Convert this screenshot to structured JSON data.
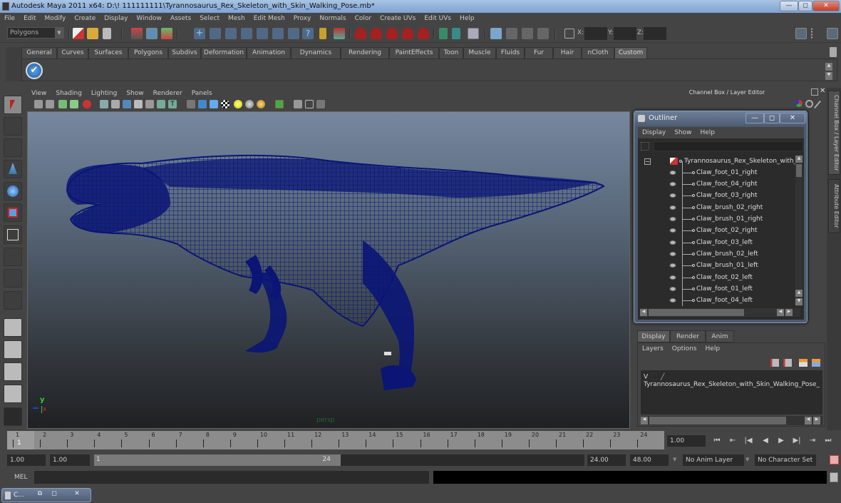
{
  "window": {
    "title": "Autodesk Maya 2011 x64: D:\\! 111111111\\Tyrannosaurus_Rex_Skeleton_with_Skin_Walking_Pose.mb*",
    "minimize": "—",
    "maximize": "◻",
    "close": "✕"
  },
  "menubar": [
    "File",
    "Edit",
    "Modify",
    "Create",
    "Display",
    "Window",
    "Assets",
    "Select",
    "Mesh",
    "Edit Mesh",
    "Proxy",
    "Normals",
    "Color",
    "Create UVs",
    "Edit UVs",
    "Help"
  ],
  "statusline": {
    "mode": "Polygons",
    "coords": {
      "x_label": "X:",
      "y_label": "Y:",
      "z_label": "Z:",
      "x": "",
      "y": "",
      "z": ""
    }
  },
  "shelf": {
    "tabs": [
      "General",
      "Curves",
      "Surfaces",
      "Polygons",
      "Subdivs",
      "Deformation",
      "Animation",
      "Dynamics",
      "Rendering",
      "PaintEffects",
      "Toon",
      "Muscle",
      "Fluids",
      "Fur",
      "Hair",
      "nCloth",
      "Custom"
    ],
    "active_tab": "Custom"
  },
  "viewport": {
    "menu": [
      "View",
      "Shading",
      "Lighting",
      "Show",
      "Renderer",
      "Panels"
    ],
    "camera_label": "persp",
    "axis": {
      "x": "x",
      "y": "y",
      "z": "z"
    },
    "wireframe_color": "#0a1575"
  },
  "channel_box": {
    "header": "Channel Box / Layer Editor",
    "side_tabs": [
      "Channel Box / Layer Editor",
      "Attribute Editor"
    ]
  },
  "outliner": {
    "title": "Outliner",
    "menu": [
      "Display",
      "Show",
      "Help"
    ],
    "search_value": "",
    "root": "Tyrannosaurus_Rex_Skeleton_with_Skin",
    "items": [
      "Claw_foot_01_right",
      "Claw_foot_04_right",
      "Claw_foot_03_right",
      "Claw_brush_02_right",
      "Claw_brush_01_right",
      "Claw_foot_02_right",
      "Claw_foot_03_left",
      "Claw_brush_02_left",
      "Claw_brush_01_left",
      "Claw_foot_02_left",
      "Claw_foot_01_left",
      "Claw_foot_04_left"
    ]
  },
  "layer_editor": {
    "tabs": [
      "Display",
      "Render",
      "Anim"
    ],
    "active_tab": "Display",
    "menu": [
      "Layers",
      "Options",
      "Help"
    ],
    "layers": [
      {
        "visible": "V",
        "name": "Tyrannosaurus_Rex_Skeleton_with_Skin_Walking_Pose_"
      }
    ]
  },
  "timeline": {
    "ticks": [
      "1",
      "2",
      "3",
      "4",
      "5",
      "6",
      "7",
      "8",
      "9",
      "10",
      "11",
      "12",
      "13",
      "14",
      "15",
      "16",
      "17",
      "18",
      "19",
      "20",
      "21",
      "22",
      "23",
      "24"
    ],
    "current_frame_marker": "1",
    "current_time": "1.00"
  },
  "range": {
    "start_time": "1.00",
    "playback_start": "1.00",
    "range_start_label": "1",
    "range_end_label": "24",
    "playback_end": "24.00",
    "end_time": "48.00",
    "anim_layer": "No Anim Layer",
    "character_set": "No Character Set"
  },
  "playback": [
    "⏮",
    "⇤",
    "|◀",
    "◀",
    "▶",
    "▶|",
    "⇥",
    "⏭"
  ],
  "command_line": {
    "label": "MEL",
    "value": "",
    "result": ""
  },
  "minimized_window": {
    "title": "C..."
  }
}
